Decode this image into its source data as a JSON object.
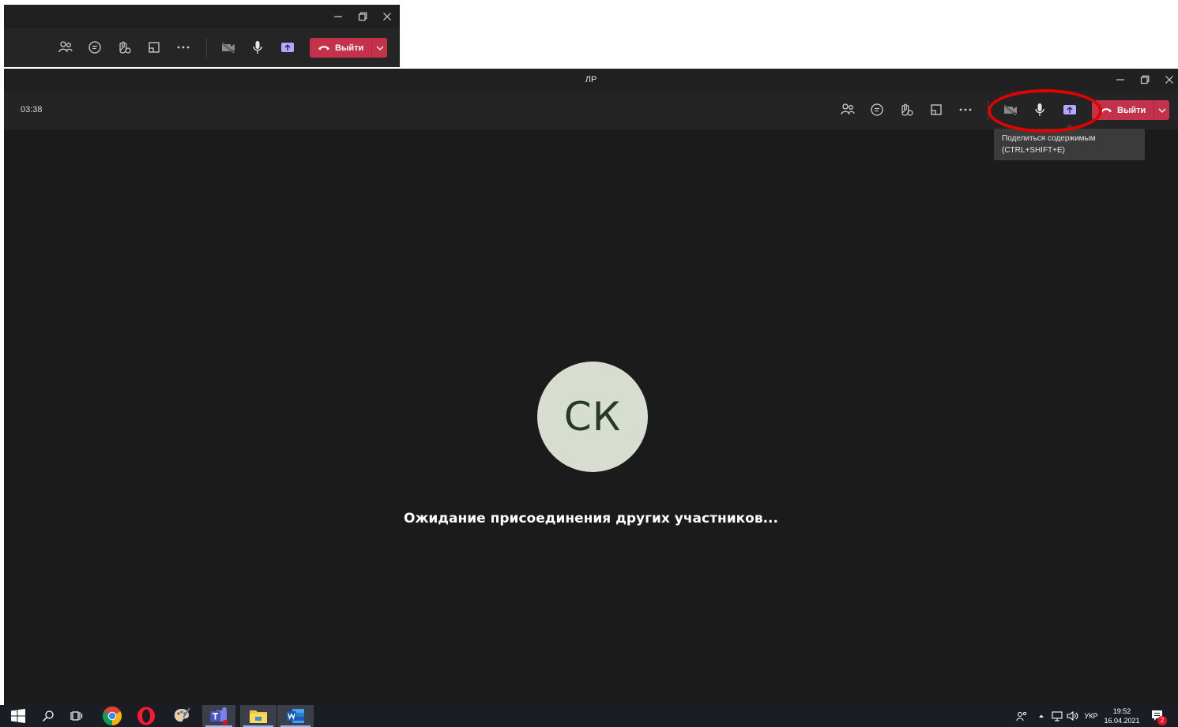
{
  "inset": {
    "leave_label": "Выйти"
  },
  "window": {
    "title": "ЛР",
    "timer": "03:38",
    "leave_label": "Выйти",
    "tooltip_line1": "Поделиться содержимым",
    "tooltip_line2": "(CTRL+SHIFT+E)",
    "avatar_initials": "СК",
    "waiting_text": "Ожидание присоединения других участников..."
  },
  "colors": {
    "accent_leave": "#c4314b",
    "share_accent": "#b4a7ff",
    "highlight": "#e00000",
    "avatar_bg": "#d7ded1",
    "avatar_fg": "#283a21"
  },
  "taskbar": {
    "language": "УКР",
    "time": "19:52",
    "date": "16.04.2021",
    "notification_count": "2",
    "apps": [
      "windows-start",
      "search",
      "task-view",
      "chrome",
      "opera",
      "paint",
      "teams",
      "file-explorer",
      "word"
    ]
  }
}
